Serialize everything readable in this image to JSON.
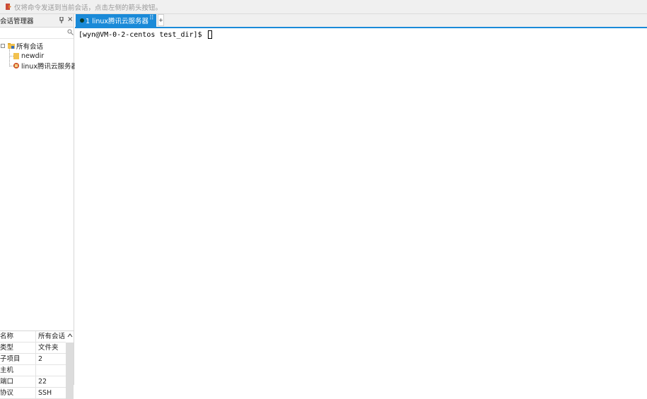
{
  "hint_bar": {
    "text": "仅将命令发送到当前会话，点击左侧的箭头按钮。"
  },
  "session_manager": {
    "title": "会话管理器",
    "tree": [
      {
        "label": "所有会话",
        "level": 0
      },
      {
        "label": "newdir",
        "level": 1
      },
      {
        "label": "linux腾讯云服务器",
        "level": 1
      }
    ]
  },
  "properties": {
    "rows": [
      {
        "key": "名称",
        "value": "所有会话"
      },
      {
        "key": "类型",
        "value": "文件夹"
      },
      {
        "key": "子项目",
        "value": "2"
      },
      {
        "key": "主机",
        "value": ""
      },
      {
        "key": "端口",
        "value": "22"
      },
      {
        "key": "协议",
        "value": "SSH"
      }
    ]
  },
  "tabs": [
    {
      "label": "1 linux腾讯云服务器",
      "active": true
    }
  ],
  "terminal": {
    "prompt": "[wyn@VM-0-2-centos test_dir]$ "
  },
  "colors": {
    "accent": "#1a8ad8",
    "panel_bg": "#f0f0f0"
  }
}
